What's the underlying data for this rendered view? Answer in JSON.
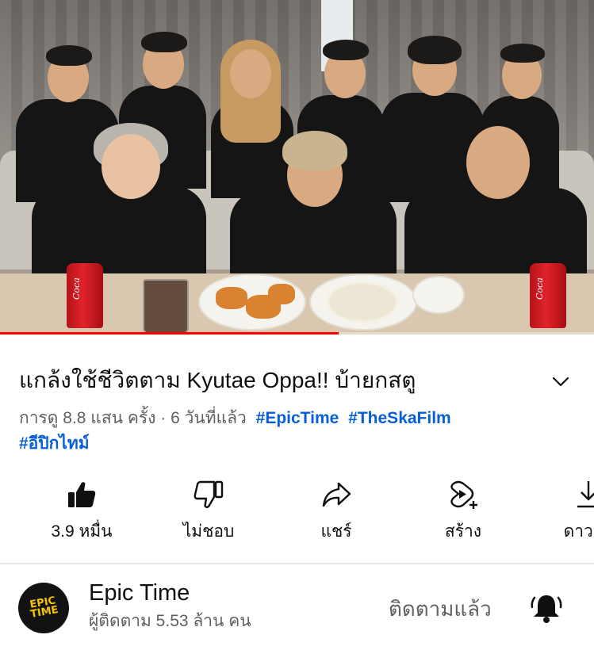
{
  "video": {
    "progress_fraction": 0.57,
    "can_text": "Coca"
  },
  "title": "แกล้งใช้ชีวิตตาม Kyutae Oppa!! บ้ายกสตู",
  "meta": {
    "views": "การดู 8.8 แสน ครั้ง",
    "separator": "·",
    "age": "6 วันที่แล้ว",
    "hashtags": [
      "#EpicTime",
      "#TheSkaFilm",
      "#อีปิกไทม์"
    ]
  },
  "actions": {
    "like_label": "3.9 หมื่น",
    "dislike_label": "ไม่ชอบ",
    "share_label": "แชร์",
    "create_label": "สร้าง",
    "download_label": "ดาวน์โ"
  },
  "channel": {
    "name": "Epic Time",
    "subscribers": "ผู้ติดตาม 5.53 ล้าน คน",
    "subscribed_label": "ติดตามแล้ว",
    "avatar_text": "EPIC TIME"
  },
  "colors": {
    "accent": "#ff0000",
    "link": "#065fd4",
    "secondary_text": "#606060",
    "avatar_text": "#f5c400"
  },
  "icons": {
    "like": "thumbs-up-icon",
    "dislike": "thumbs-down-icon",
    "share": "share-arrow-icon",
    "create": "create-remix-icon",
    "download": "download-icon",
    "expand": "chevron-down-icon",
    "bell": "bell-icon"
  }
}
